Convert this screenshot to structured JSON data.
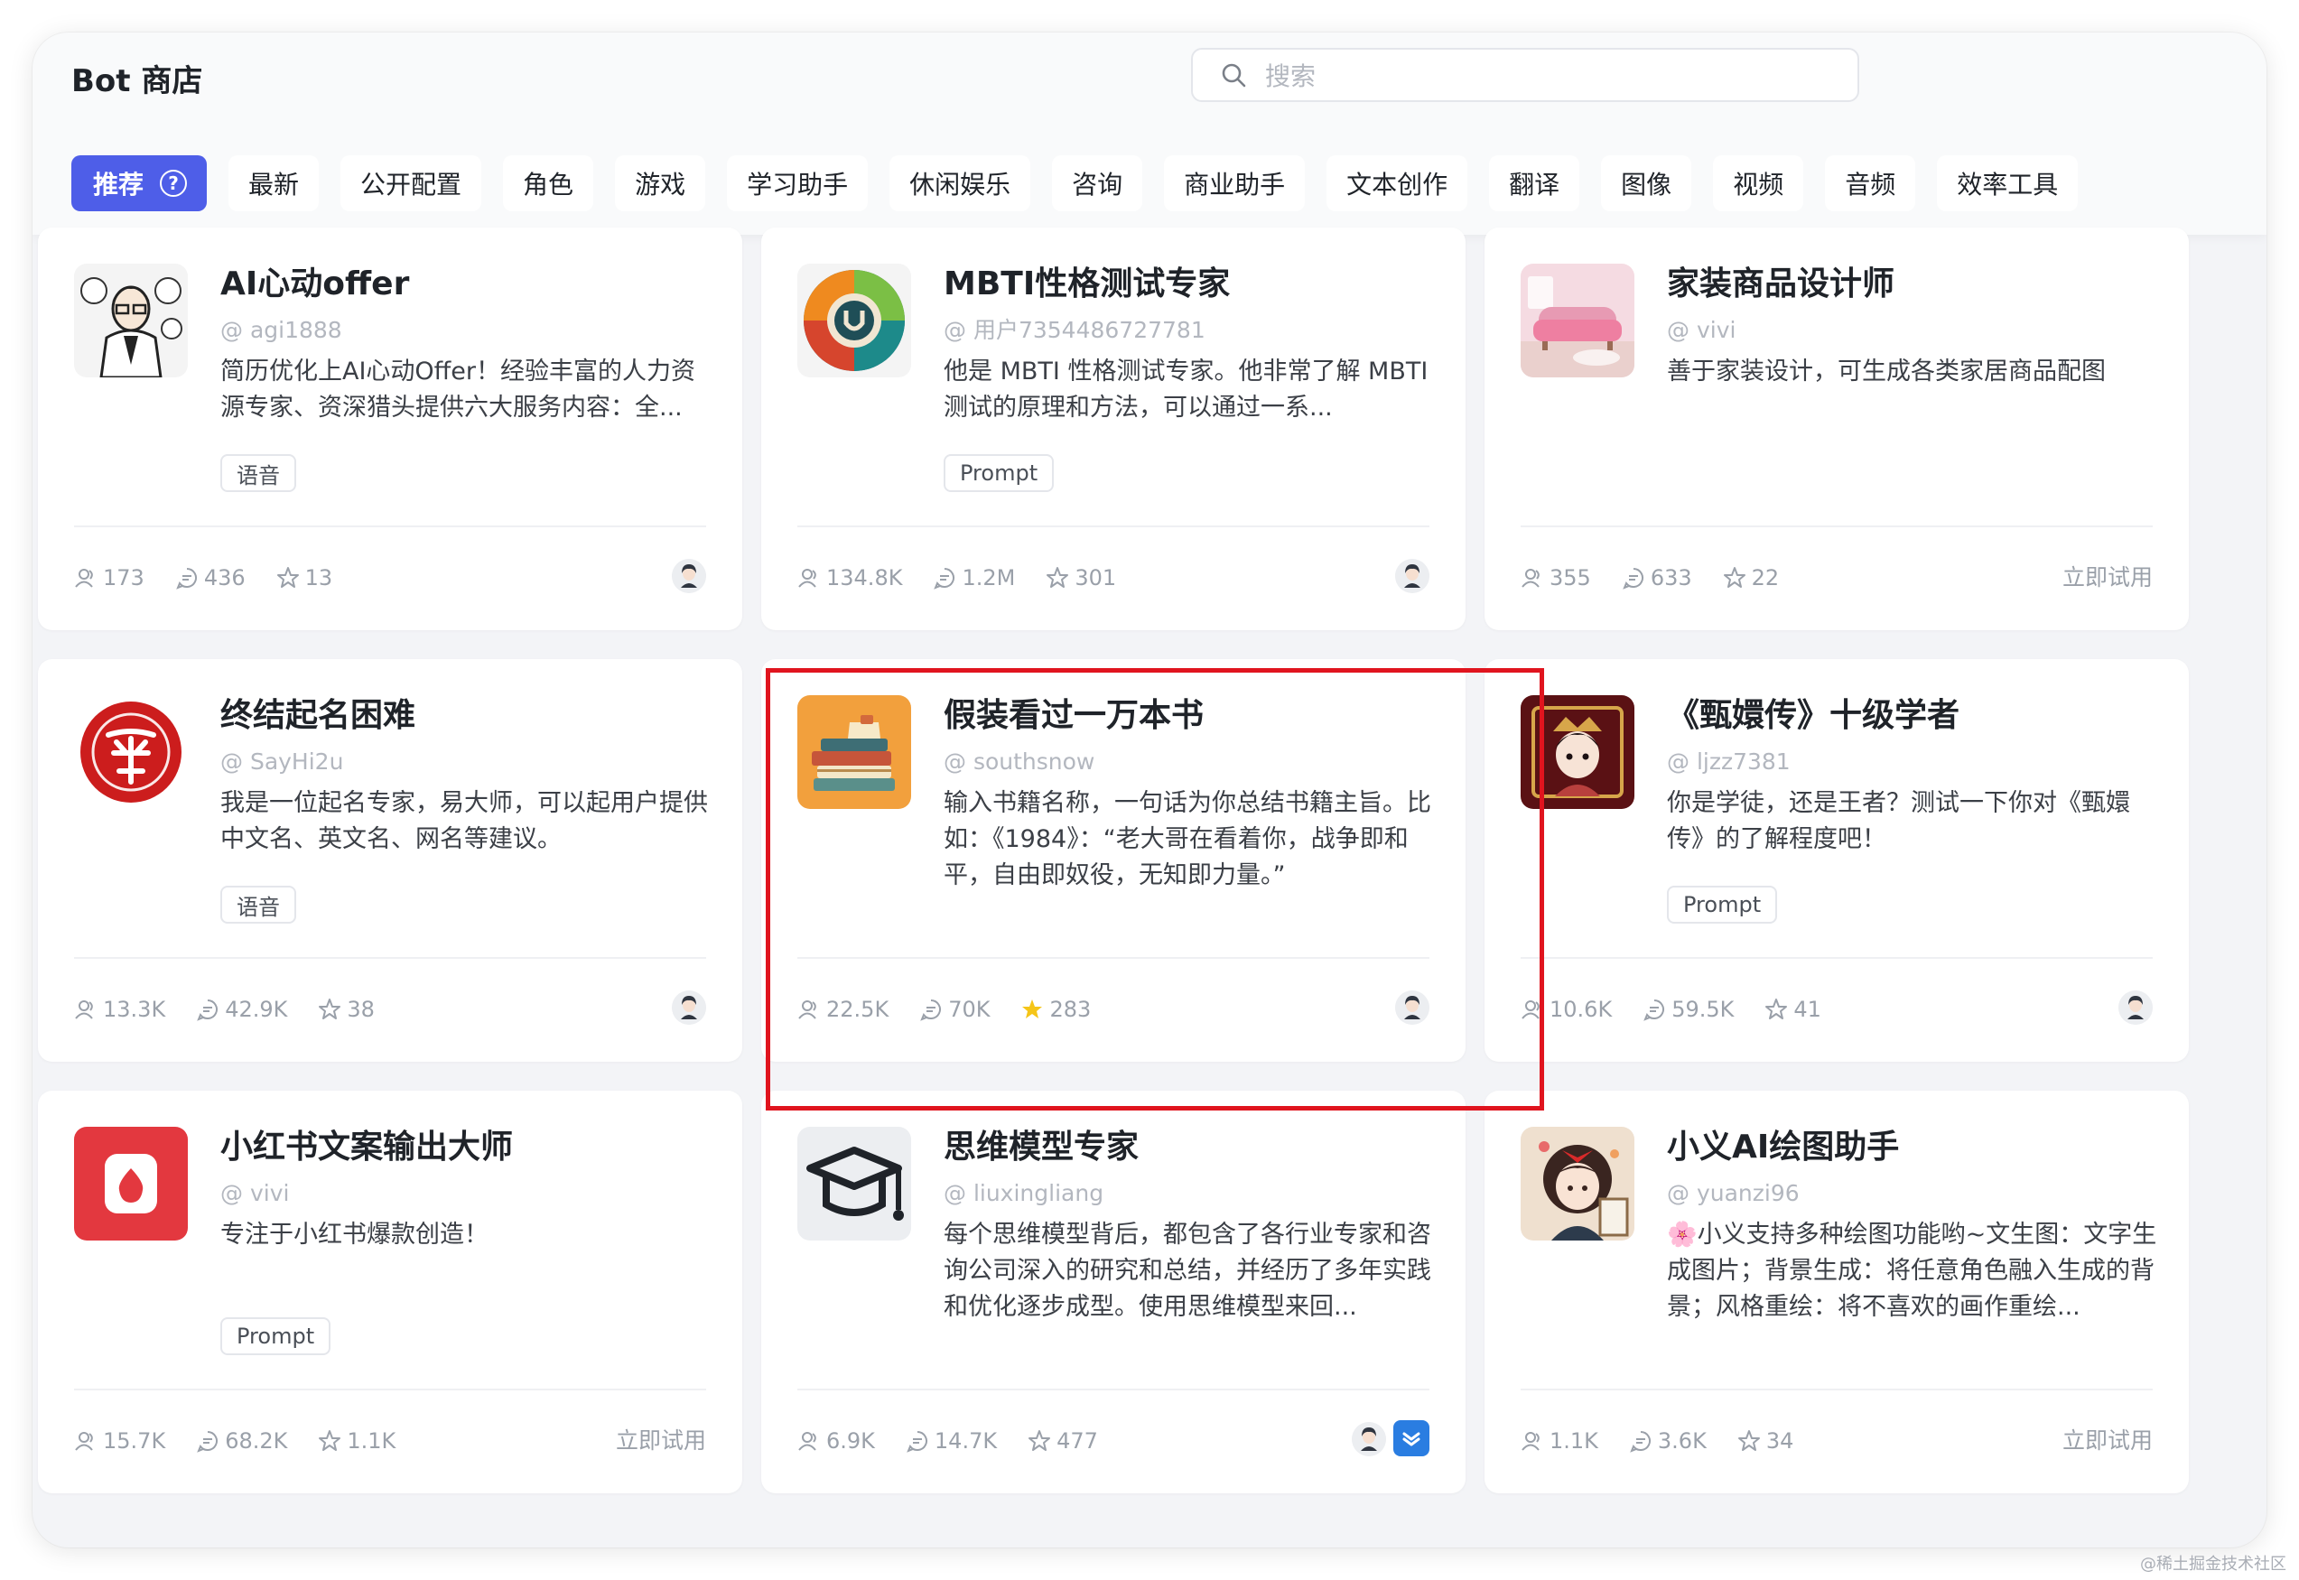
{
  "app": {
    "title": "Bot 商店"
  },
  "search": {
    "placeholder": "搜索",
    "value": ""
  },
  "categories": [
    "推荐",
    "最新",
    "公开配置",
    "角色",
    "游戏",
    "学习助手",
    "休闲娱乐",
    "咨询",
    "商业助手",
    "文本创作",
    "翻译",
    "图像",
    "视频",
    "音频",
    "效率工具"
  ],
  "active_category": "推荐",
  "bots": [
    {
      "title": "AI心动offer",
      "author": "@ agi1888",
      "description": "简历优化上AI心动Offer！经验丰富的人力资源专家、资深猎头提供六大服务内容：全...",
      "tag": "语音",
      "users": "173",
      "chats": "436",
      "stars": "13",
      "starred": false,
      "action": "",
      "avatar": "lawyer-portrait"
    },
    {
      "title": "MBTI性格测试专家",
      "author": "@ 用户7354486727781",
      "description": "他是 MBTI 性格测试专家。他非常了解 MBTI 测试的原理和方法，可以通过一系...",
      "tag": "Prompt",
      "users": "134.8K",
      "chats": "1.2M",
      "stars": "301",
      "starred": false,
      "action": "",
      "avatar": "color-wheel"
    },
    {
      "title": "家装商品设计师",
      "author": "@ vivi",
      "description": "善于家装设计，可生成各类家居商品配图",
      "tag": "",
      "users": "355",
      "chats": "633",
      "stars": "22",
      "starred": false,
      "action": "立即试用",
      "avatar": "pink-sofa"
    },
    {
      "title": "终结起名困难",
      "author": "@ SayHi2u",
      "description": "我是一位起名专家，易大师，可以起用户提供中文名、英文名、网名等建议。",
      "tag": "语音",
      "users": "13.3K",
      "chats": "42.9K",
      "stars": "38",
      "starred": false,
      "action": "",
      "avatar": "red-seal"
    },
    {
      "title": "假装看过一万本书",
      "author": "@ southsnow",
      "description": "输入书籍名称，一句话为你总结书籍主旨。比如：《1984》：“老大哥在看着你，战争即和平，自由即奴役，无知即力量。”",
      "tag": "",
      "users": "22.5K",
      "chats": "70K",
      "stars": "283",
      "starred": true,
      "action": "",
      "avatar": "book-stack"
    },
    {
      "title": "《甄嬛传》十级学者",
      "author": "@ ljzz7381",
      "description": "你是学徒，还是王者？测试一下你对《甄嬛传》的了解程度吧！",
      "tag": "Prompt",
      "users": "10.6K",
      "chats": "59.5K",
      "stars": "41",
      "starred": false,
      "action": "",
      "avatar": "empress"
    },
    {
      "title": "小红书文案输出大师",
      "author": "@ vivi",
      "description": "专注于小红书爆款创造！",
      "tag": "Prompt",
      "users": "15.7K",
      "chats": "68.2K",
      "stars": "1.1K",
      "starred": false,
      "action": "立即试用",
      "avatar": "red-note"
    },
    {
      "title": "思维模型专家",
      "author": "@ liuxingliang",
      "description": "每个思维模型背后，都包含了各行业专家和咨询公司深入的研究和总结，并经历了多年实践和优化逐步成型。使用思维模型来回...",
      "tag": "",
      "users": "6.9K",
      "chats": "14.7K",
      "stars": "477",
      "starred": false,
      "action": "",
      "avatar": "grad-cap"
    },
    {
      "title": "小义AI绘图助手",
      "author": "@ yuanzi96",
      "description": "🌸小义支持多种绘图功能哟~文生图：文字生成图片；背景生成：将任意角色融入生成的背景；风格重绘：将不喜欢的画作重绘...",
      "tag": "",
      "users": "1.1K",
      "chats": "3.6K",
      "stars": "34",
      "starred": false,
      "action": "立即试用",
      "avatar": "painter-girl"
    }
  ],
  "colors": {
    "accent": "#4e5ee8",
    "highlight_border": "#e0141e",
    "star_active": "#f5c518"
  },
  "watermark": "@稀土掘金技术社区"
}
